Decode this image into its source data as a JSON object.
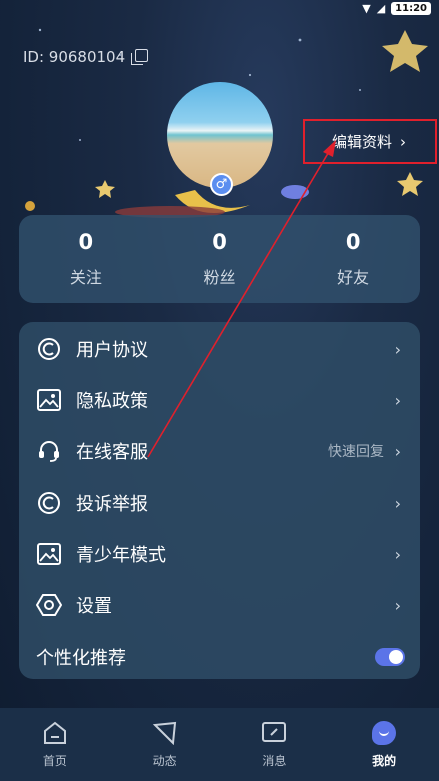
{
  "status_bar": {
    "time": "11:20"
  },
  "profile": {
    "id_text": "ID: 90680104",
    "edit_label": "编辑资料",
    "gender_symbol": "♂"
  },
  "stats": [
    {
      "value": "0",
      "label": "关注"
    },
    {
      "value": "0",
      "label": "粉丝"
    },
    {
      "value": "0",
      "label": "好友"
    }
  ],
  "menu": {
    "items": [
      {
        "label": "用户协议",
        "icon": "protocol-circle-icon"
      },
      {
        "label": "隐私政策",
        "icon": "image-icon"
      },
      {
        "label": "在线客服",
        "icon": "headset-icon",
        "hint": "快速回复"
      },
      {
        "label": "投诉举报",
        "icon": "report-circle-icon"
      },
      {
        "label": "青少年模式",
        "icon": "image-icon"
      },
      {
        "label": "设置",
        "icon": "settings-hexagon-icon"
      }
    ],
    "recommend": {
      "label": "个性化推荐",
      "enabled": true
    }
  },
  "nav": {
    "items": [
      {
        "label": "首页",
        "icon": "home-icon"
      },
      {
        "label": "动态",
        "icon": "moments-icon"
      },
      {
        "label": "消息",
        "icon": "message-icon"
      },
      {
        "label": "我的",
        "icon": "me-icon",
        "active": true
      }
    ]
  },
  "colors": {
    "accent": "#5b74e8",
    "highlight_box": "#e0202c",
    "annotation_arrow": "#e0202c"
  }
}
